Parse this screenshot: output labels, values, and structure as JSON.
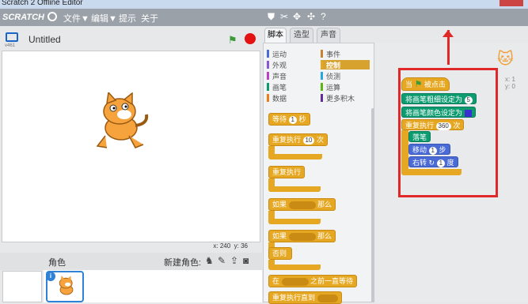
{
  "window": {
    "title": "Scratch 2 Offline Editor"
  },
  "menubar": {
    "logo": "SCRATCH",
    "items": [
      "文件▼",
      "编辑▼",
      "提示",
      "关于"
    ]
  },
  "stage": {
    "version": "v461",
    "title": "Untitled",
    "coords": {
      "x_label": "x: 240",
      "y_label": "y: 36"
    }
  },
  "sprites": {
    "label": "角色",
    "new_sprite": "新建角色:"
  },
  "tabs": [
    "脚本",
    "造型",
    "声音"
  ],
  "categories": [
    {
      "name": "运动",
      "color": "#4a6bd6"
    },
    {
      "name": "事件",
      "color": "#c88330"
    },
    {
      "name": "外观",
      "color": "#8a55d7"
    },
    {
      "name": "控制",
      "color": "#e6a822",
      "selected": true
    },
    {
      "name": "声音",
      "color": "#bb42c3"
    },
    {
      "name": "侦测",
      "color": "#2ca5e2"
    },
    {
      "name": "画笔",
      "color": "#0e9a6c"
    },
    {
      "name": "运算",
      "color": "#5cb712"
    },
    {
      "name": "数据",
      "color": "#ee7d16"
    },
    {
      "name": "更多积木",
      "color": "#632d99"
    }
  ],
  "palette_blocks": {
    "wait": {
      "a": "等待",
      "n": "1",
      "b": "秒"
    },
    "repeat": {
      "a": "重复执行",
      "n": "10",
      "b": "次"
    },
    "forever": "重复执行",
    "if_then": {
      "a": "如果",
      "b": "那么"
    },
    "if_else": {
      "a": "如果",
      "b": "那么",
      "else": "否则"
    },
    "wait_until": {
      "a": "在",
      "b": "之前一直等待"
    },
    "repeat_until": "重复执行直到"
  },
  "script": {
    "hat": {
      "a": "当",
      "b": "被点击"
    },
    "set_size": {
      "label": "将画笔粗细设定为",
      "value": "5"
    },
    "set_color": {
      "label": "将画笔颜色设定为"
    },
    "repeat": {
      "a": "重复执行",
      "n": "360",
      "b": "次"
    },
    "pen_down": "落笔",
    "move": {
      "a": "移动",
      "n": "1",
      "b": "步"
    },
    "turn": {
      "a": "右转",
      "n": "1",
      "b": "度"
    }
  },
  "corner": {
    "x_label": "x: 1",
    "y_label": "y: 0"
  },
  "colors": {
    "control": "#e6a822",
    "pen": "#0d9c70",
    "motion": "#4a6bd6",
    "highlight": "#e02828",
    "pen_color_swatch": "#3b2fd0"
  }
}
